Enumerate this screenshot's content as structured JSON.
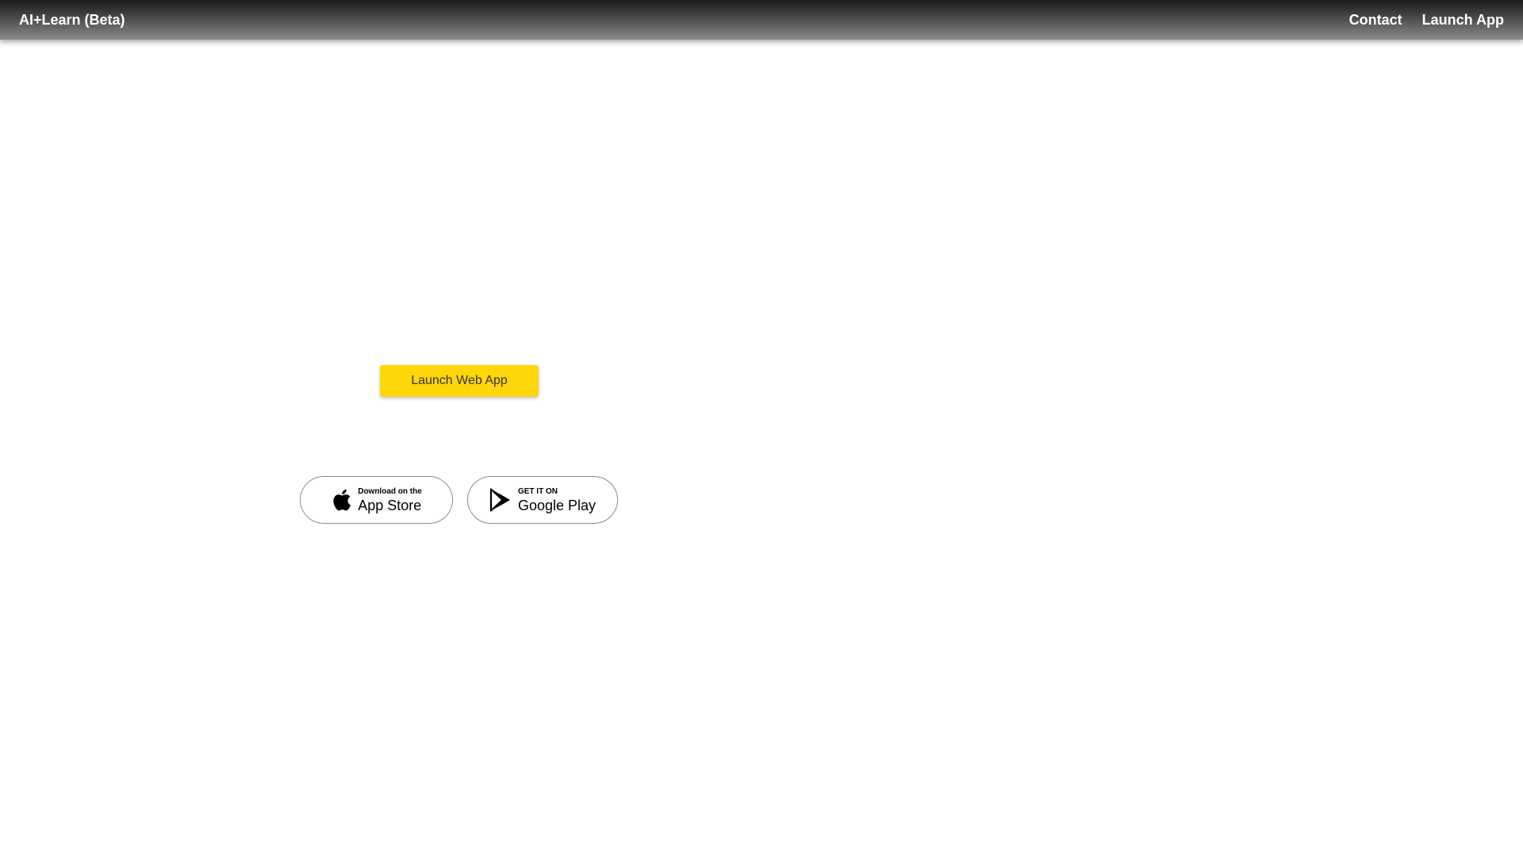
{
  "header": {
    "brand": "AI+Learn (Beta)",
    "nav": [
      {
        "label": "Contact"
      },
      {
        "label": "Launch App"
      }
    ]
  },
  "main": {
    "launch_button_label": "Launch Web App",
    "badges": {
      "appstore": {
        "small": "Download on the",
        "big": "App Store",
        "icon": "apple-icon"
      },
      "googleplay": {
        "small": "GET IT ON",
        "big": "Google Play",
        "icon": "play-store-icon"
      }
    }
  },
  "colors": {
    "accent": "#FFD60A",
    "header_dark": "#1b1b1b"
  }
}
